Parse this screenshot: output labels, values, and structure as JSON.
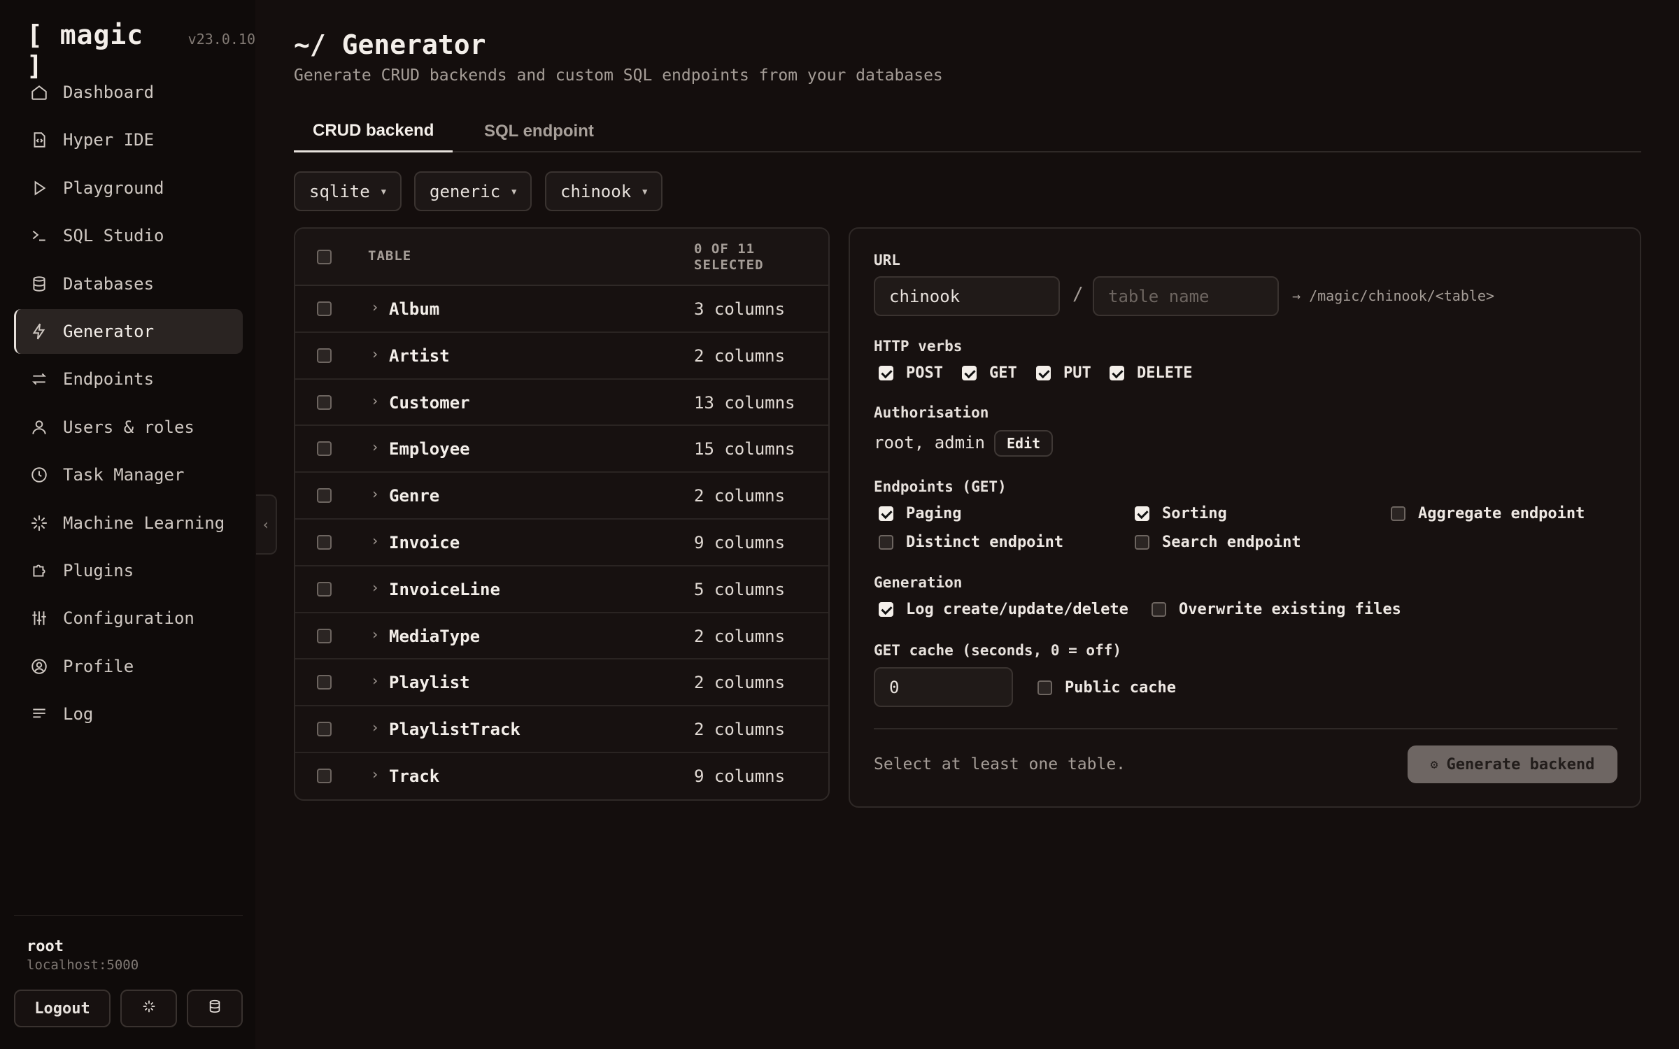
{
  "app": {
    "name": "[ magic ]",
    "version": "v23.0.10"
  },
  "sidebar": {
    "items": [
      {
        "label": "Dashboard",
        "icon": "home-icon"
      },
      {
        "label": "Hyper IDE",
        "icon": "code-file-icon"
      },
      {
        "label": "Playground",
        "icon": "play-icon"
      },
      {
        "label": "SQL Studio",
        "icon": "terminal-icon"
      },
      {
        "label": "Databases",
        "icon": "database-icon"
      },
      {
        "label": "Generator",
        "icon": "lightning-icon",
        "active": true
      },
      {
        "label": "Endpoints",
        "icon": "arrows-icon"
      },
      {
        "label": "Users & roles",
        "icon": "user-icon"
      },
      {
        "label": "Task Manager",
        "icon": "clock-icon"
      },
      {
        "label": "Machine Learning",
        "icon": "sparkle-icon"
      },
      {
        "label": "Plugins",
        "icon": "puzzle-icon"
      },
      {
        "label": "Configuration",
        "icon": "sliders-icon"
      },
      {
        "label": "Profile",
        "icon": "profile-icon"
      },
      {
        "label": "Log",
        "icon": "lines-icon"
      }
    ],
    "user": {
      "name": "root",
      "host": "localhost:5000"
    },
    "logout_label": "Logout"
  },
  "page": {
    "title": "~/ Generator",
    "subtitle": "Generate CRUD backends and custom SQL endpoints from your databases"
  },
  "tabs": [
    {
      "label": "CRUD backend",
      "active": true
    },
    {
      "label": "SQL endpoint",
      "active": false
    }
  ],
  "selectors": {
    "database_type": "sqlite",
    "connection": "generic",
    "database": "chinook"
  },
  "tables": {
    "header_label": "TABLE",
    "header_count": "0 OF 11 SELECTED",
    "rows": [
      {
        "name": "Album",
        "columns": "3 columns"
      },
      {
        "name": "Artist",
        "columns": "2 columns"
      },
      {
        "name": "Customer",
        "columns": "13 columns"
      },
      {
        "name": "Employee",
        "columns": "15 columns"
      },
      {
        "name": "Genre",
        "columns": "2 columns"
      },
      {
        "name": "Invoice",
        "columns": "9 columns"
      },
      {
        "name": "InvoiceLine",
        "columns": "5 columns"
      },
      {
        "name": "MediaType",
        "columns": "2 columns"
      },
      {
        "name": "Playlist",
        "columns": "2 columns"
      },
      {
        "name": "PlaylistTrack",
        "columns": "2 columns"
      },
      {
        "name": "Track",
        "columns": "9 columns"
      }
    ]
  },
  "config": {
    "url_label": "URL",
    "url_module": "chinook",
    "url_table_placeholder": "table name",
    "url_preview": "→ /magic/chinook/<table>",
    "verbs_label": "HTTP verbs",
    "verbs": [
      {
        "label": "POST",
        "checked": true
      },
      {
        "label": "GET",
        "checked": true
      },
      {
        "label": "PUT",
        "checked": true
      },
      {
        "label": "DELETE",
        "checked": true
      }
    ],
    "auth_label": "Authorisation",
    "auth_value": "root, admin",
    "edit_label": "Edit",
    "endpoints_label": "Endpoints (GET)",
    "endpoints": [
      {
        "label": "Paging",
        "checked": true
      },
      {
        "label": "Sorting",
        "checked": true
      },
      {
        "label": "Aggregate endpoint",
        "checked": false
      },
      {
        "label": "Distinct endpoint",
        "checked": false
      },
      {
        "label": "Search endpoint",
        "checked": false
      }
    ],
    "generation_label": "Generation",
    "generation": [
      {
        "label": "Log create/update/delete",
        "checked": true
      },
      {
        "label": "Overwrite existing files",
        "checked": false
      }
    ],
    "cache_label": "GET cache (seconds, 0 = off)",
    "cache_value": "0",
    "public_cache_label": "Public cache",
    "public_cache_checked": false,
    "hint": "Select at least one table.",
    "generate_label": "Generate backend",
    "generate_icon": "gear-icon"
  }
}
